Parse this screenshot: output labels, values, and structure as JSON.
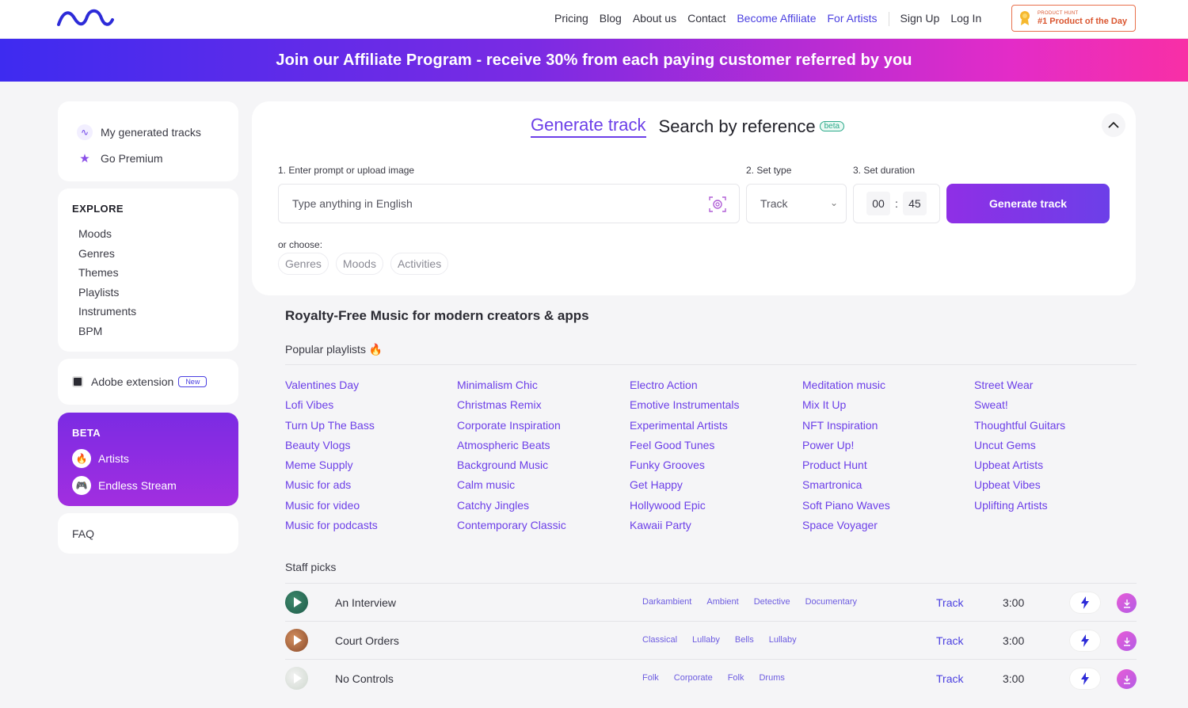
{
  "nav": {
    "links": [
      {
        "label": "Pricing",
        "accent": false
      },
      {
        "label": "Blog",
        "accent": false
      },
      {
        "label": "About us",
        "accent": false
      },
      {
        "label": "Contact",
        "accent": false
      },
      {
        "label": "Become Affiliate",
        "accent": true
      },
      {
        "label": "For Artists",
        "accent": true
      }
    ],
    "signup": "Sign Up",
    "login": "Log In",
    "badge_small": "PRODUCT HUNT",
    "badge_big": "#1 Product of the Day"
  },
  "banner": {
    "text": "Join our Affiliate Program - receive 30% from each paying customer referred by you"
  },
  "sidebar": {
    "top": [
      {
        "label": "My generated tracks",
        "icon": "wave-icon"
      },
      {
        "label": "Go Premium",
        "icon": "star-icon"
      }
    ],
    "explore_title": "EXPLORE",
    "explore": [
      "Moods",
      "Genres",
      "Themes",
      "Playlists",
      "Instruments",
      "BPM"
    ],
    "adobe": {
      "label": "Adobe extension",
      "badge": "New"
    },
    "beta": {
      "title": "BETA",
      "items": [
        {
          "label": "Artists",
          "icon": "fire-icon"
        },
        {
          "label": "Endless Stream",
          "icon": "gamepad-icon"
        }
      ]
    },
    "faq": "FAQ"
  },
  "generator": {
    "tab_active": "Generate track",
    "tab_other": "Search by reference",
    "beta_pill": "beta",
    "step1": "1. Enter prompt or upload image",
    "step2": "2. Set type",
    "step3": "3. Set duration",
    "prompt_placeholder": "Type anything in English",
    "type_value": "Track",
    "dur_min": "00",
    "dur_sep": ":",
    "dur_sec": "45",
    "button": "Generate track",
    "or_choose": "or choose:",
    "chips": [
      "Genres",
      "Moods",
      "Activities"
    ]
  },
  "main": {
    "heading": "Royalty-Free Music for modern creators & apps",
    "popular_label": "Popular playlists 🔥",
    "playlists": [
      [
        "Valentines Day",
        "Lofi Vibes",
        "Turn Up The Bass",
        "Beauty Vlogs",
        "Meme Supply",
        "Music for ads",
        "Music for video",
        "Music for podcasts"
      ],
      [
        "Minimalism Chic",
        "Christmas Remix",
        "Corporate Inspiration",
        "Atmospheric Beats",
        "Background Music",
        "Calm music",
        "Catchy Jingles",
        "Contemporary Classic"
      ],
      [
        "Electro Action",
        "Emotive Instrumentals",
        "Experimental Artists",
        "Feel Good Tunes",
        "Funky Grooves",
        "Get Happy",
        "Hollywood Epic",
        "Kawaii Party"
      ],
      [
        "Meditation music",
        "Mix It Up",
        "NFT Inspiration",
        "Power Up!",
        "Product Hunt",
        "Smartronica",
        "Soft Piano Waves",
        "Space Voyager"
      ],
      [
        "Street Wear",
        "Sweat!",
        "Thoughtful Guitars",
        "Uncut Gems",
        "Upbeat Artists",
        "Upbeat Vibes",
        "Uplifting Artists"
      ]
    ],
    "staff_label": "Staff picks",
    "tracks": [
      {
        "name": "An Interview",
        "tags": [
          "Darkambient",
          "Ambient",
          "Detective",
          "Documentary"
        ],
        "type": "Track",
        "duration": "3:00",
        "thumb_colors": [
          "#1d5a4a",
          "#3f8a6c"
        ]
      },
      {
        "name": "Court Orders",
        "tags": [
          "Classical",
          "Lullaby",
          "Bells",
          "Lullaby"
        ],
        "type": "Track",
        "duration": "3:00",
        "thumb_colors": [
          "#8a4a2a",
          "#d49060"
        ]
      },
      {
        "name": "No Controls",
        "tags": [
          "Folk",
          "Corporate",
          "Folk",
          "Drums"
        ],
        "type": "Track",
        "duration": "3:00",
        "thumb_colors": [
          "#cfd8cf",
          "#f2f2f2"
        ]
      }
    ]
  }
}
